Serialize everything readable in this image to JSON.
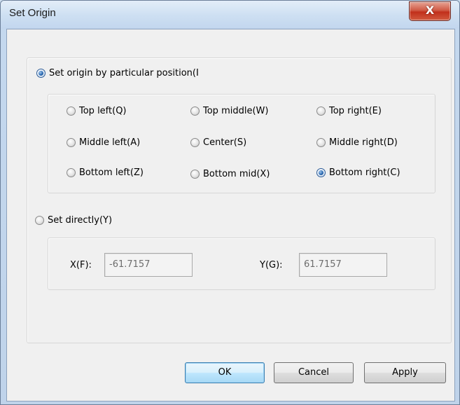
{
  "window": {
    "title": "Set Origin",
    "close_symbol": "X"
  },
  "mode": {
    "particular_label": "Set origin by particular position(I",
    "particular_selected": true,
    "direct_label": "Set directly(Y)",
    "direct_selected": false
  },
  "positions": [
    {
      "label": "Top left(Q)",
      "selected": false
    },
    {
      "label": "Top middle(W)",
      "selected": false
    },
    {
      "label": "Top right(E)",
      "selected": false
    },
    {
      "label": "Middle left(A)",
      "selected": false
    },
    {
      "label": "Center(S)",
      "selected": false
    },
    {
      "label": "Middle right(D)",
      "selected": false
    },
    {
      "label": "Bottom left(Z)",
      "selected": false
    },
    {
      "label": "Bottom mid(X)",
      "selected": false
    },
    {
      "label": "Bottom right(C)",
      "selected": true
    }
  ],
  "direct": {
    "x_label": "X(F):",
    "x_value": "-61.7157",
    "y_label": "Y(G):",
    "y_value": "61.7157"
  },
  "buttons": {
    "ok": "OK",
    "cancel": "Cancel",
    "apply": "Apply"
  },
  "colors": {
    "accent": "#2e6db4",
    "close_button": "#c1301c"
  }
}
